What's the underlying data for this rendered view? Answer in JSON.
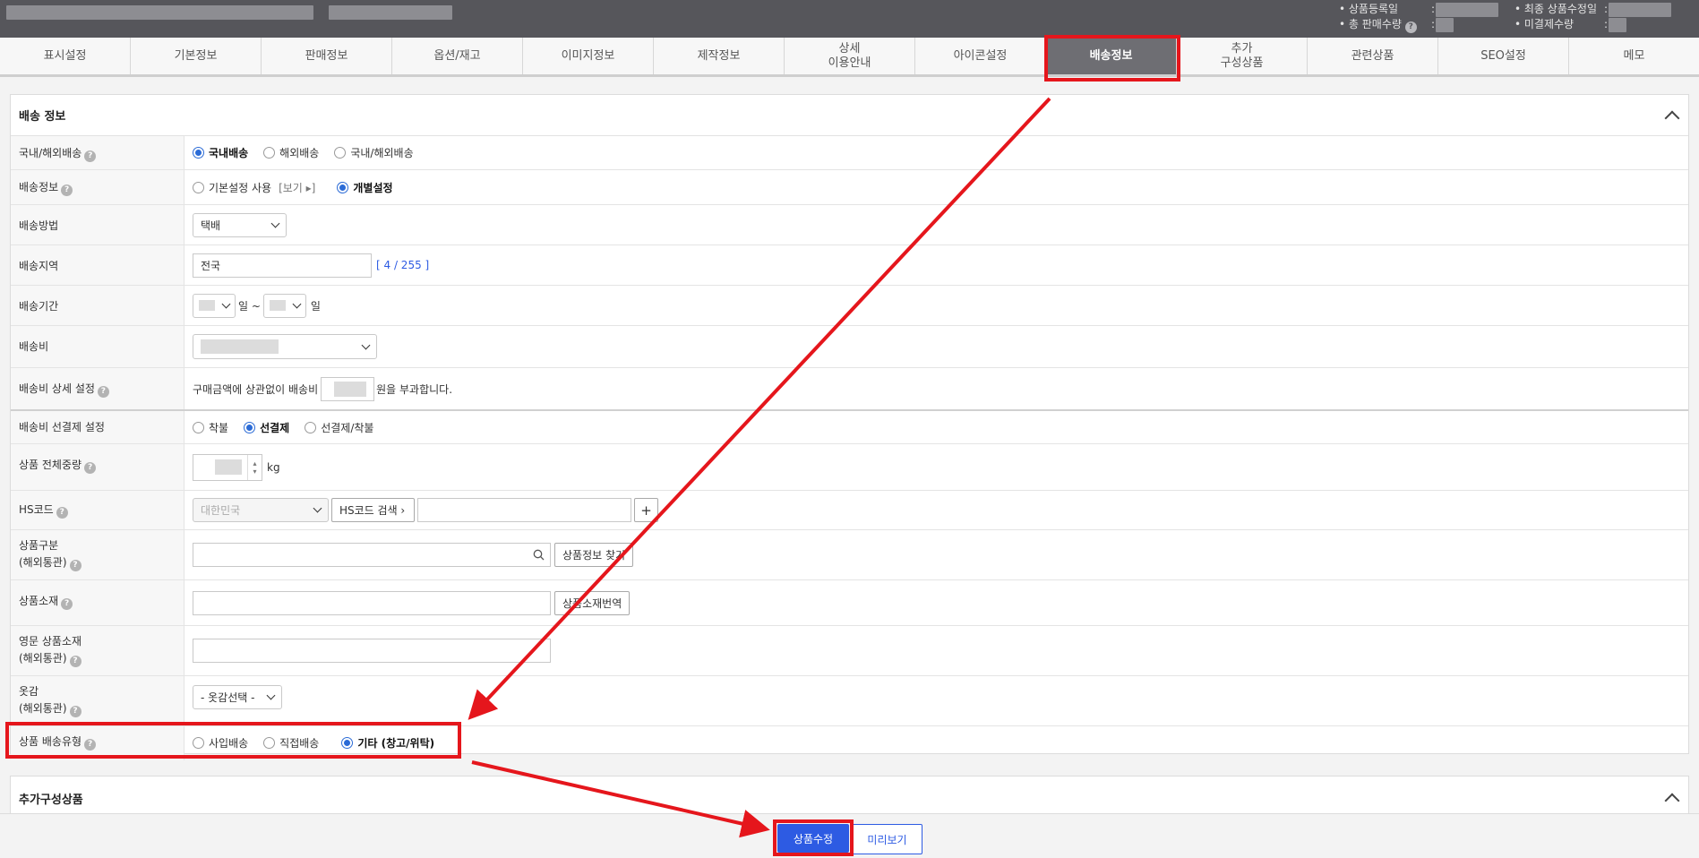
{
  "header": {
    "meta": {
      "registered_label": "• 상품등록일",
      "total_sales_label": "• 총 판매수량",
      "last_modified_label": "• 최종 상품수정일",
      "unpaid_label": "• 미결제수량",
      "colon": ":"
    }
  },
  "tabs": [
    {
      "label": "표시설정"
    },
    {
      "label": "기본정보"
    },
    {
      "label": "판매정보"
    },
    {
      "label": "옵션/재고"
    },
    {
      "label": "이미지정보"
    },
    {
      "label": "제작정보"
    },
    {
      "label": "상세\n이용안내"
    },
    {
      "label": "아이콘설정"
    },
    {
      "label": "배송정보",
      "active": true
    },
    {
      "label": "추가\n구성상품"
    },
    {
      "label": "관련상품"
    },
    {
      "label": "SEO설정"
    },
    {
      "label": "메모"
    }
  ],
  "shipping_panel": {
    "title": "배송 정보",
    "rows": {
      "domestic": {
        "label": "국내/해외배송",
        "options": [
          "국내배송",
          "해외배송",
          "국내/해외배송"
        ],
        "selected": "국내배송"
      },
      "shipping_info": {
        "label": "배송정보",
        "options": [
          "기본설정 사용",
          "개별설정"
        ],
        "view_link": "[보기 ▸]",
        "selected": "개별설정"
      },
      "method": {
        "label": "배송방법",
        "value": "택배"
      },
      "region": {
        "label": "배송지역",
        "value": "전국",
        "counter": "[ 4 / 255 ]"
      },
      "period": {
        "label": "배송기간",
        "unit1": "일 ~",
        "unit2": "일"
      },
      "fee": {
        "label": "배송비"
      },
      "fee_detail": {
        "label": "배송비 상세 설정",
        "text_before": "구매금액에 상관없이 배송비",
        "text_after": "원을 부과합니다."
      },
      "prepay": {
        "label": "배송비 선결제 설정",
        "options": [
          "착불",
          "선결제",
          "선결제/착불"
        ],
        "selected": "선결제"
      },
      "weight": {
        "label": "상품 전체중량",
        "unit": "kg"
      },
      "hscode": {
        "label": "HS코드",
        "country": "대한민국",
        "search_button": "HS코드 검색 ›",
        "add_button": "+"
      },
      "category": {
        "label": "상품구분\n(해외통관)",
        "find_button": "상품정보 찾기"
      },
      "material": {
        "label": "상품소재",
        "translate_button": "상품소재번역"
      },
      "material_en": {
        "label": "영문 상품소재\n(해외통관)"
      },
      "fabric": {
        "label": "옷감\n(해외통관)",
        "placeholder": "- 옷감선택 -"
      },
      "delivery_type": {
        "label": "상품 배송유형",
        "options": [
          "사입배송",
          "직접배송",
          "기타 (창고/위탁)"
        ],
        "selected": "기타 (창고/위탁)"
      }
    }
  },
  "extra_panel": {
    "title": "추가구성상품"
  },
  "footer": {
    "save_button": "상품수정",
    "preview_button": "미리보기"
  },
  "colors": {
    "highlight": "#e5161c",
    "primary": "#2d5be3",
    "radio": "#2b6bd6",
    "topbar": "#56565b",
    "active_tab": "#6e6e73"
  }
}
